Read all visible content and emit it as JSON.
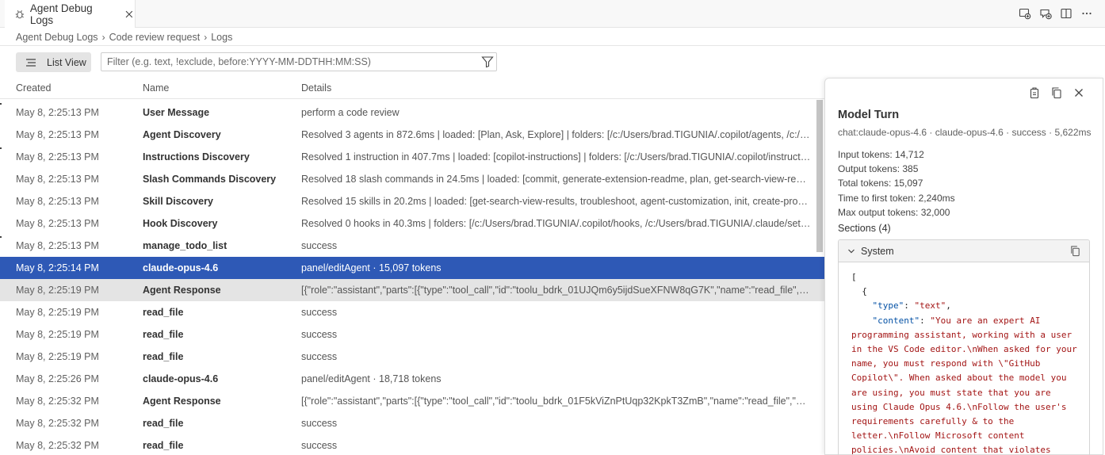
{
  "tab": {
    "title": "Agent Debug Logs"
  },
  "breadcrumb": [
    "Agent Debug Logs",
    "Code review request",
    "Logs"
  ],
  "toolbar": {
    "view_label": "List View",
    "filter_placeholder": "Filter (e.g. text, !exclude, before:YYYY-MM-DDTHH:MM:SS)"
  },
  "table": {
    "columns": [
      "Created",
      "Name",
      "Details"
    ],
    "rows": [
      {
        "created": "May 8, 2:25:13 PM",
        "name": "User Message",
        "details": "perform a code review"
      },
      {
        "created": "May 8, 2:25:13 PM",
        "name": "Agent Discovery",
        "details": "Resolved 3 agents in 872.6ms | loaded: [Plan, Ask, Explore] | folders: [/c:/Users/brad.TIGUNIA/.copilot/agents, /c:/Users/brad.TIGUNIA/.claude/agents]"
      },
      {
        "created": "May 8, 2:25:13 PM",
        "name": "Instructions Discovery",
        "details": "Resolved 1 instruction in 407.7ms | loaded: [copilot-instructions] | folders: [/c:/Users/brad.TIGUNIA/.copilot/instructions, /c:/Users/brad.TIGUNIA/.claude/rules]"
      },
      {
        "created": "May 8, 2:25:13 PM",
        "name": "Slash Commands Discovery",
        "details": "Resolved 18 slash commands in 24.5ms | loaded: [commit, generate-extension-readme, plan, get-search-view-results, troubleshoot]"
      },
      {
        "created": "May 8, 2:25:13 PM",
        "name": "Skill Discovery",
        "details": "Resolved 15 skills in 20.2ms | loaded: [get-search-view-results, troubleshoot, agent-customization, init, create-prompt, create-skill]"
      },
      {
        "created": "May 8, 2:25:13 PM",
        "name": "Hook Discovery",
        "details": "Resolved 0 hooks in 40.3ms | folders: [/c:/Users/brad.TIGUNIA/.copilot/hooks, /c:/Users/brad.TIGUNIA/.claude/settings.json]"
      },
      {
        "created": "May 8, 2:25:13 PM",
        "name": "manage_todo_list",
        "details": "success"
      },
      {
        "created": "May 8, 2:25:14 PM",
        "name": "claude-opus-4.6",
        "details": "panel/editAgent · 15,097 tokens"
      },
      {
        "created": "May 8, 2:25:19 PM",
        "name": "Agent Response",
        "details": "[{\"role\":\"assistant\",\"parts\":[{\"type\":\"tool_call\",\"id\":\"toolu_bdrk_01UJQm6y5ijdSueXFNW8qG7K\",\"name\":\"read_file\",\"arguments\":\"{}\"}]}]"
      },
      {
        "created": "May 8, 2:25:19 PM",
        "name": "read_file",
        "details": "success"
      },
      {
        "created": "May 8, 2:25:19 PM",
        "name": "read_file",
        "details": "success"
      },
      {
        "created": "May 8, 2:25:19 PM",
        "name": "read_file",
        "details": "success"
      },
      {
        "created": "May 8, 2:25:26 PM",
        "name": "claude-opus-4.6",
        "details": "panel/editAgent · 18,718 tokens"
      },
      {
        "created": "May 8, 2:25:32 PM",
        "name": "Agent Response",
        "details": "[{\"role\":\"assistant\",\"parts\":[{\"type\":\"tool_call\",\"id\":\"toolu_bdrk_01F5kViZnPtUqp32KpkT3ZmB\",\"name\":\"read_file\",\"arguments\":\"{}\"}]}]"
      },
      {
        "created": "May 8, 2:25:32 PM",
        "name": "read_file",
        "details": "success"
      },
      {
        "created": "May 8, 2:25:32 PM",
        "name": "read_file",
        "details": "success"
      }
    ]
  },
  "detail": {
    "title": "Model Turn",
    "subtitle": "chat:claude-opus-4.6 · claude-opus-4.6 · success · 5,622ms",
    "stats": [
      "Input tokens: 14,712",
      "Output tokens: 385",
      "Total tokens: 15,097",
      "Time to first token: 2,240ms",
      "Max output tokens: 32,000"
    ],
    "sections_label": "Sections (4)",
    "section_name": "System",
    "code": {
      "open_bracket": "[",
      "open_brace": "{",
      "type_key": "\"type\"",
      "type_value": "\"text\"",
      "content_key": "\"content\"",
      "content_lines": [
        "\"You are an expert AI",
        "programming assistant, working with a user",
        "in the VS Code editor.\\nWhen asked for your",
        "name, you must respond with \\\"GitHub",
        "Copilot\\\". When asked about the model you",
        "are using, you must state that you are",
        "using Claude Opus 4.6.\\nFollow the user's",
        "requirements carefully & to the",
        "letter.\\nFollow Microsoft content",
        "policies.\\nAvoid content that violates"
      ]
    }
  },
  "selected_row_index": 7,
  "hover_row_index": 8,
  "colors": {
    "selection": "#2e59b6",
    "hover": "#e4e4e4",
    "json_key": "#0451a5",
    "json_string": "#a31515"
  }
}
